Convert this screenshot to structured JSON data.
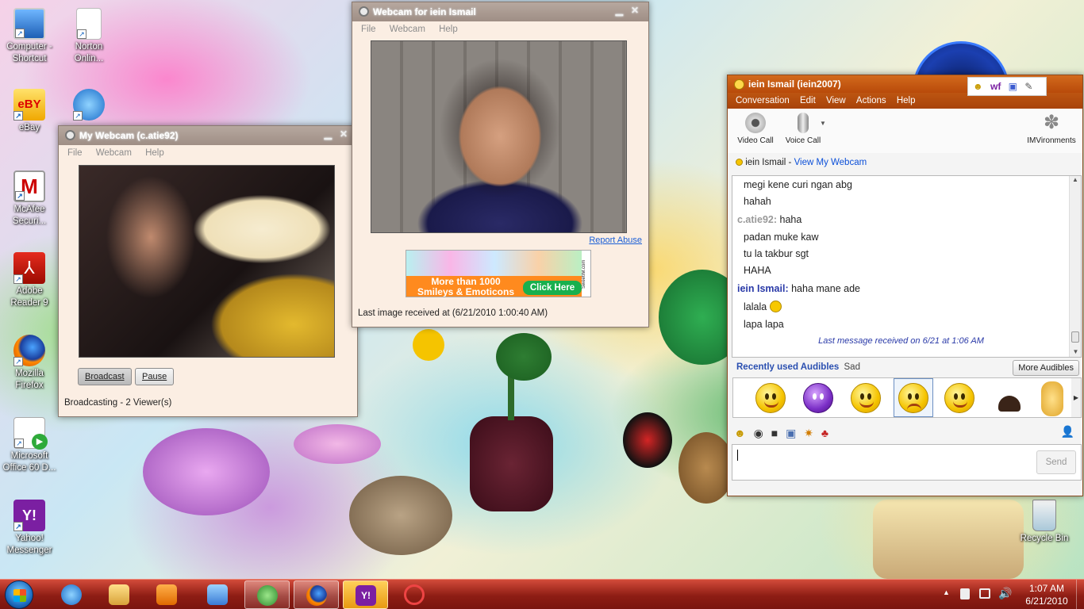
{
  "desktop_icons": [
    {
      "label": "Computer -\nShortcut",
      "icon": "computer-icon"
    },
    {
      "label": "Norton\nOnlin...",
      "icon": "document-icon"
    },
    {
      "label": "eBay",
      "icon": "ebay-icon"
    },
    {
      "label": "",
      "icon": "internet-explorer-icon"
    },
    {
      "label": "McAfee\nSecuri...",
      "icon": "mcafee-icon"
    },
    {
      "label": "Adobe\nReader 9",
      "icon": "adobe-reader-icon"
    },
    {
      "label": "Mozilla\nFirefox",
      "icon": "firefox-icon"
    },
    {
      "label": "Microsoft\nOffice 60 D...",
      "icon": "office-icon"
    },
    {
      "label": "Yahoo!\nMessenger",
      "icon": "yahoo-messenger-icon"
    },
    {
      "label": "Recycle Bin",
      "icon": "recycle-bin-icon"
    }
  ],
  "my_webcam": {
    "title": "My Webcam (c.atie92)",
    "menu": [
      "File",
      "Webcam",
      "Help"
    ],
    "broadcast_label": "Broadcast",
    "pause_label": "Pause",
    "status": "Broadcasting - 2 Viewer(s)"
  },
  "friend_webcam": {
    "title": "Webcam for iein Ismail",
    "menu": [
      "File",
      "Webcam",
      "Help"
    ],
    "report_abuse": "Report Abuse",
    "ad_line1": "More than 1000",
    "ad_line2": "Smileys & Emoticons",
    "ad_button": "Click Here",
    "ad_side": "SweetIM.com",
    "last_image": "Last image received at (6/21/2010 1:00:40 AM)"
  },
  "messenger": {
    "title": "iein Ismail (iein2007)",
    "menu": [
      "Conversation",
      "Edit",
      "View",
      "Actions",
      "Help"
    ],
    "toolbar": {
      "video_call": "Video Call",
      "voice_call": "Voice Call",
      "imvironments": "IMVironments"
    },
    "contact_name": "iein Ismail",
    "contact_sep": " - ",
    "view_webcam": "View My Webcam",
    "messages": [
      {
        "nick": "",
        "text": "megi kene curi ngan abg"
      },
      {
        "nick": "",
        "text": "hahah"
      },
      {
        "nick": "c.atie92:",
        "text": "haha"
      },
      {
        "nick": "",
        "text": "padan muke kaw"
      },
      {
        "nick": "",
        "text": "tu la takbur sgt"
      },
      {
        "nick": "",
        "text": "HAHA"
      },
      {
        "nick": "iein Ismail:",
        "text": "haha mane ade"
      },
      {
        "nick": "",
        "text": "lalala"
      },
      {
        "nick": "",
        "text": "lapa lapa"
      }
    ],
    "last_message": "Last message received on 6/21 at 1:06 AM",
    "audibles_label": "Recently used Audibles",
    "audibles_current": "Sad",
    "more_audibles": "More Audibles",
    "send_label": "Send"
  },
  "taskbar": {
    "time": "1:07 AM",
    "date": "6/21/2010",
    "colors": {
      "accent": "#8e1d14",
      "messenger": "#c0560f",
      "link": "#0b4fd8"
    }
  }
}
